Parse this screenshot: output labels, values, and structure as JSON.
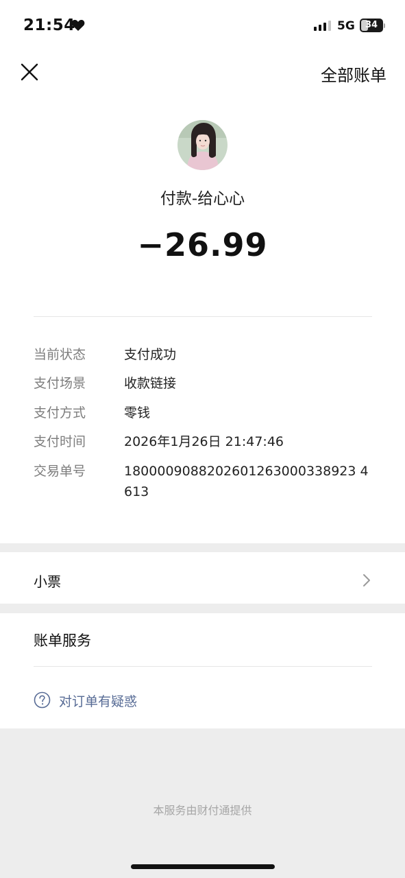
{
  "status_bar": {
    "time": "21:54",
    "network": "5G",
    "battery_level": 34,
    "battery_text": "34",
    "heart_icon": "heart-icon",
    "signal_icon": "signal-icon"
  },
  "nav": {
    "close_icon": "close-icon",
    "all_bills_label": "全部账单"
  },
  "header": {
    "payee": "付款-给心心",
    "amount": "−26.99"
  },
  "details": [
    {
      "label": "当前状态",
      "value": "支付成功"
    },
    {
      "label": "支付场景",
      "value": "收款链接"
    },
    {
      "label": "支付方式",
      "value": "零钱"
    },
    {
      "label": "支付时间",
      "value": "2026年1月26日 21:47:46"
    },
    {
      "label": "交易单号",
      "value": "1800009088202601263000338923 4613"
    }
  ],
  "receipt": {
    "label": "小票",
    "chevron_icon": "chevron-right-icon"
  },
  "bill_service": {
    "title": "账单服务",
    "question_label": "对订单有疑惑",
    "question_icon": "question-circle-icon"
  },
  "footer": {
    "text": "本服务由财付通提供"
  },
  "colors": {
    "link": "#576b95",
    "label_gray": "#7d7d7d",
    "background": "#ededed"
  }
}
